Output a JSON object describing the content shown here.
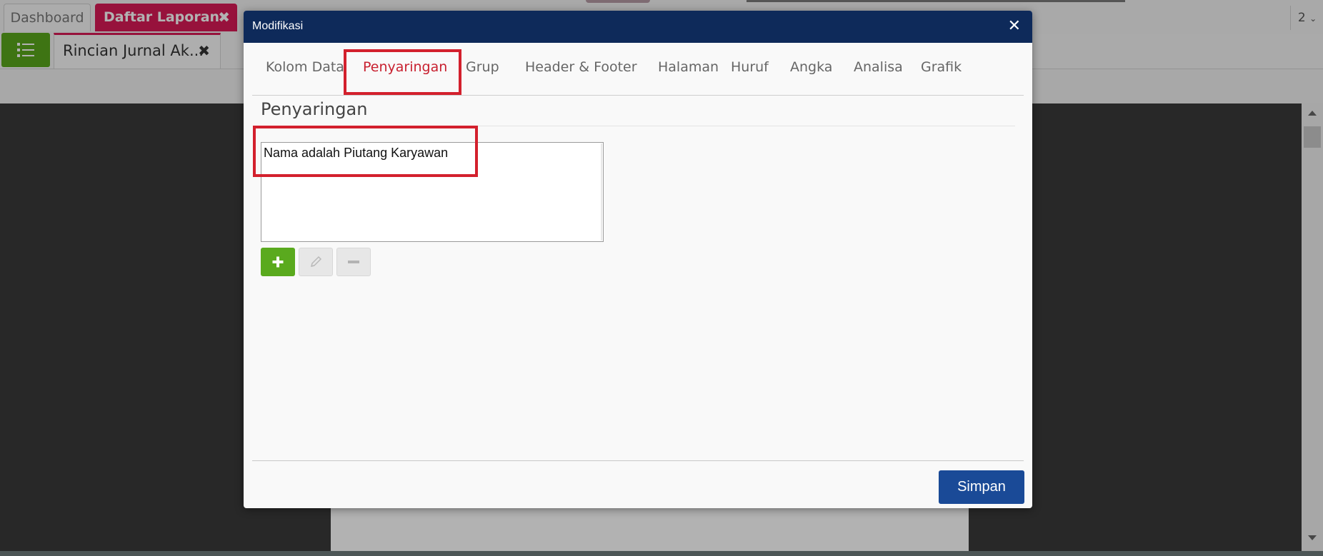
{
  "app": {
    "top_tabs": [
      {
        "label": "Dashboard"
      },
      {
        "label": "Daftar Laporan"
      }
    ],
    "sub_tab": {
      "label": "Rincian Jurnal Ak..."
    },
    "pager": "2"
  },
  "modal": {
    "title": "Modifikasi",
    "tabs": [
      {
        "label": "Kolom Data"
      },
      {
        "label": "Penyaringan",
        "active": true
      },
      {
        "label": "Grup"
      },
      {
        "label": "Header & Footer"
      },
      {
        "label": "Halaman"
      },
      {
        "label": "Huruf"
      },
      {
        "label": "Angka"
      },
      {
        "label": "Analisa"
      },
      {
        "label": "Grafik"
      }
    ],
    "section_title": "Penyaringan",
    "filters": [
      {
        "text": "Nama adalah Piutang Karyawan"
      }
    ],
    "buttons": {
      "add_icon": "plus-icon",
      "edit_icon": "pencil-icon",
      "remove_icon": "minus-icon",
      "save_label": "Simpan"
    }
  },
  "colors": {
    "header": "#0e2a5a",
    "active_tab": "#c8202f",
    "accent_pink": "#d81b56",
    "add_green": "#5aaa1e",
    "save_blue": "#1a4a97",
    "highlight": "#d3202d"
  }
}
